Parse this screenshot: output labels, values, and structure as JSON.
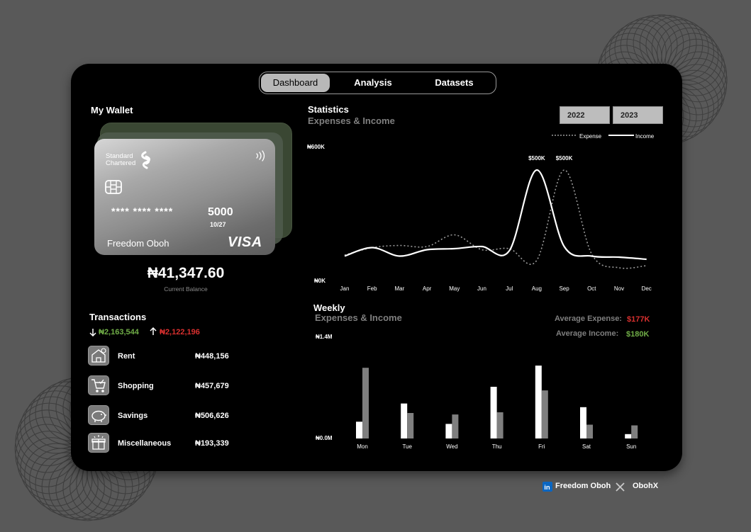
{
  "nav": {
    "tabs": [
      {
        "label": "Dashboard",
        "active": true
      },
      {
        "label": "Analysis",
        "active": false
      },
      {
        "label": "Datasets",
        "active": false
      }
    ]
  },
  "wallet": {
    "title": "My Wallet",
    "card": {
      "bank_line1": "Standard",
      "bank_line2": "Chartered",
      "masked": "**** **** ****",
      "last4": "5000",
      "expiry": "10/27",
      "holder": "Freedom Oboh",
      "brand": "VISA"
    },
    "balance": "₦41,347.60",
    "balance_label": "Current Balance"
  },
  "transactions": {
    "title": "Transactions",
    "income_total": "₦2,163,544",
    "expense_total": "₦2,122,196",
    "items": [
      {
        "name": "Rent",
        "amount": "₦448,156",
        "icon": "house-icon"
      },
      {
        "name": "Shopping",
        "amount": "₦457,679",
        "icon": "shopping-cart-icon"
      },
      {
        "name": "Savings",
        "amount": "₦506,626",
        "icon": "piggy-bank-icon"
      },
      {
        "name": "Miscellaneous",
        "amount": "₦193,339",
        "icon": "gift-box-icon"
      }
    ]
  },
  "statistics": {
    "title": "Statistics",
    "subtitle": "Expenses & Income",
    "years": [
      "2022",
      "2023"
    ],
    "legend": {
      "expense": "Expense",
      "income": "Income"
    },
    "y_top": "₦600K",
    "y_bottom": "₦0K",
    "peak_labels": [
      "$500K",
      "$500K"
    ]
  },
  "weekly": {
    "title": "Weekly",
    "subtitle": "Expenses & Income",
    "avg_expense_label": "Average Expense:",
    "avg_expense_value": "$177K",
    "avg_income_label": "Average Income:",
    "avg_income_value": "$180K",
    "y_top": "₦1.4M",
    "y_bottom": "₦0.0M"
  },
  "chart_data": [
    {
      "type": "line",
      "title": "Statistics",
      "subtitle": "Expenses & Income",
      "x": [
        "Jan",
        "Feb",
        "Mar",
        "Apr",
        "May",
        "Jun",
        "Jul",
        "Aug",
        "Sep",
        "Oct",
        "Nov",
        "Dec"
      ],
      "ylim": [
        0,
        600
      ],
      "series": [
        {
          "name": "Income",
          "values": [
            95,
            135,
            95,
            125,
            130,
            140,
            120,
            500,
            140,
            95,
            90,
            80
          ]
        },
        {
          "name": "Expense",
          "values": [
            100,
            135,
            145,
            140,
            195,
            125,
            130,
            75,
            500,
            105,
            40,
            50
          ]
        }
      ],
      "annotations": [
        "$500K",
        "$500K"
      ],
      "colors": {
        "income": "#ffffff",
        "expense": "#9a9a9a"
      },
      "legend": "top-right"
    },
    {
      "type": "bar",
      "title": "Weekly",
      "subtitle": "Expenses & Income",
      "categories": [
        "Mon",
        "Tue",
        "Wed",
        "Thu",
        "Fri",
        "Sat",
        "Sun"
      ],
      "ylim": [
        0,
        1.4
      ],
      "series": [
        {
          "values": [
            0.23,
            0.48,
            0.2,
            0.71,
            1.0,
            0.43,
            0.06
          ]
        },
        {
          "values": [
            0.97,
            0.35,
            0.33,
            0.36,
            0.66,
            0.19,
            0.18
          ]
        }
      ],
      "colors": [
        "#ffffff",
        "#7f7f7f"
      ]
    }
  ],
  "footer": {
    "linkedin_name": "Freedom Oboh",
    "x_handle": "ObohX",
    "linkedin_badge": "in"
  }
}
